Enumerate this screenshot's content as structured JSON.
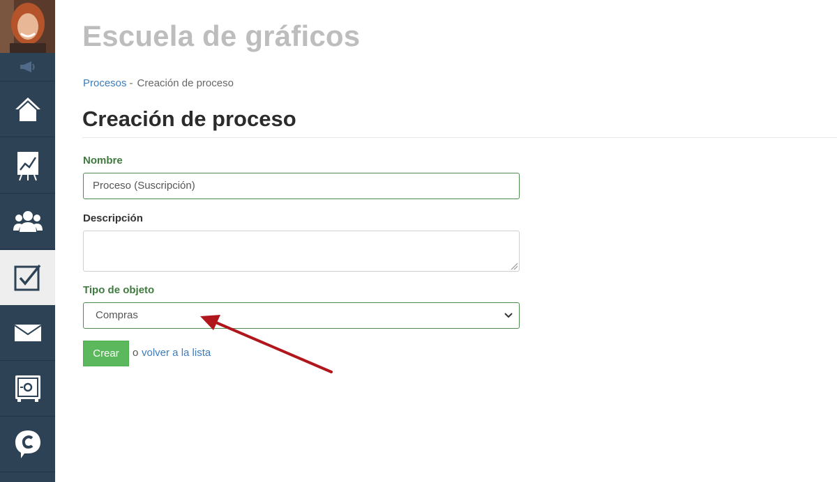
{
  "site": {
    "title": "Escuela de gráficos"
  },
  "breadcrumb": {
    "parent": "Procesos",
    "separator": "-",
    "current": "Creación de proceso"
  },
  "page": {
    "title": "Creación de proceso"
  },
  "form": {
    "name": {
      "label": "Nombre",
      "value": "Proceso (Suscripción)"
    },
    "description": {
      "label": "Descripción",
      "value": ""
    },
    "object_type": {
      "label": "Tipo de objeto",
      "selected": "Compras"
    },
    "submit_label": "Crear",
    "or_text": "o",
    "back_link": "volver a la lista"
  },
  "sidebar": {
    "items": [
      {
        "name": "home",
        "icon": "home-icon"
      },
      {
        "name": "statistics",
        "icon": "chart-board-icon"
      },
      {
        "name": "users",
        "icon": "users-group-icon"
      },
      {
        "name": "tasks",
        "icon": "checkbox-icon",
        "active": true
      },
      {
        "name": "mail",
        "icon": "envelope-icon"
      },
      {
        "name": "safe",
        "icon": "safe-icon"
      },
      {
        "name": "chat",
        "icon": "chat-bubble-icon"
      }
    ]
  },
  "colors": {
    "sidebar_bg": "#2e4256",
    "accent_green": "#5cb85c",
    "label_green": "#3f7a3f",
    "link_blue": "#3b7dbf",
    "annotation_arrow": "#b0161b"
  }
}
